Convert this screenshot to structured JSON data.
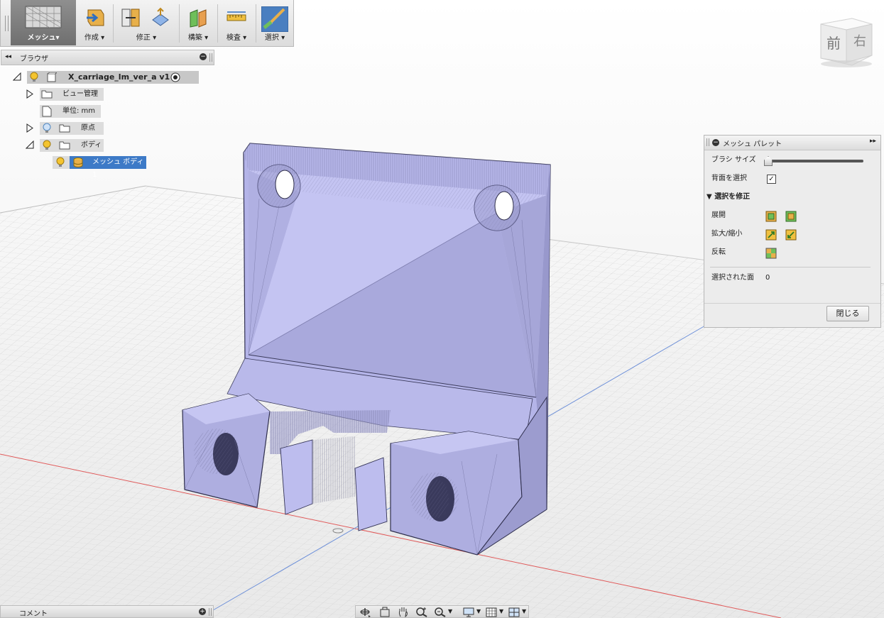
{
  "toolbar": {
    "workspace_label": "メッシュ",
    "create_label": "作成",
    "modify_label": "修正",
    "construct_label": "構築",
    "inspect_label": "検査",
    "select_label": "選択",
    "dropdown_marker": "▾"
  },
  "browser": {
    "title": "ブラウザ",
    "root_name": "X_carriage_lm_ver_a v1",
    "items": [
      {
        "label": "ビュー管理"
      },
      {
        "label": "単位: mm"
      },
      {
        "label": "原点"
      },
      {
        "label": "ボディ"
      },
      {
        "label": "メッシュ ボディ1"
      }
    ]
  },
  "viewcube": {
    "front_label": "前",
    "right_label": "右"
  },
  "palette": {
    "title": "メッシュ パレット",
    "brush_size_label": "ブラシ サイズ",
    "brush_size_value": 0,
    "backface_label": "背面を選択",
    "backface_checked": true,
    "modify_section_label": "選択を修正",
    "expand_label": "展開",
    "grow_shrink_label": "拡大/縮小",
    "invert_label": "反転",
    "selected_faces_label": "選択された面",
    "selected_faces_count": "0",
    "close_label": "閉じる"
  },
  "comments": {
    "title": "コメント"
  },
  "colors": {
    "model_fill": "#b3b3e6",
    "model_edge": "#4a4a70",
    "accent_blue": "#4f86c0",
    "selection_highlight": "#3d7ac7"
  }
}
